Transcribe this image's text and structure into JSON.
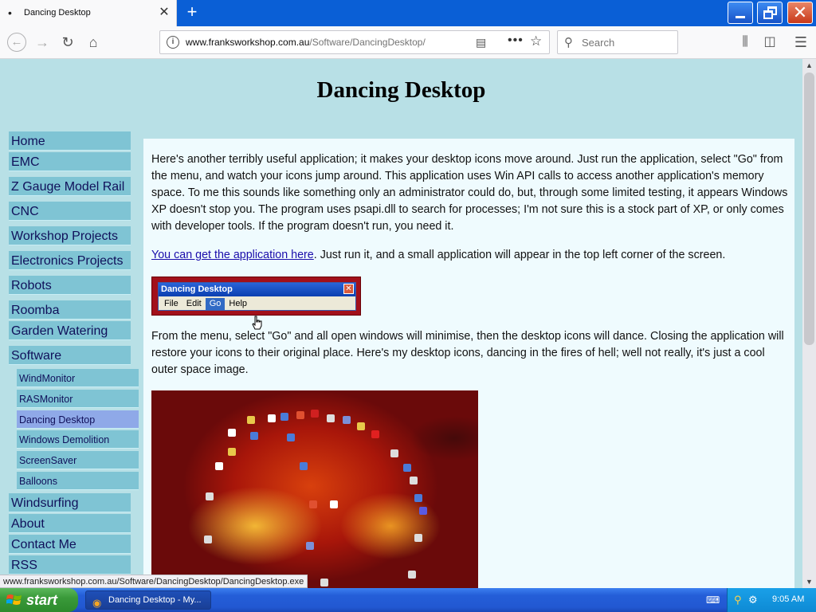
{
  "browser": {
    "tab_title": "Dancing Desktop",
    "tab_dot": "•",
    "url_host": "www.franksworkshop.com.au",
    "url_path": "/Software/DancingDesktop/",
    "search_placeholder": "Search"
  },
  "page": {
    "title": "Dancing Desktop",
    "nav": [
      {
        "label": "Home"
      },
      {
        "label": "EMC"
      },
      {
        "label": "Z Gauge Model Rail"
      },
      {
        "label": "CNC"
      },
      {
        "label": "Workshop Projects"
      },
      {
        "label": "Electronics Projects"
      },
      {
        "label": "Robots"
      },
      {
        "label": "Roomba"
      },
      {
        "label": "Garden Watering"
      },
      {
        "label": "Software"
      }
    ],
    "subnav": [
      {
        "label": "WindMonitor"
      },
      {
        "label": "RASMonitor"
      },
      {
        "label": "Dancing Desktop"
      },
      {
        "label": "Windows Demolition"
      },
      {
        "label": "ScreenSaver"
      },
      {
        "label": "Balloons"
      }
    ],
    "nav_after": [
      {
        "label": "Windsurfing"
      },
      {
        "label": "About"
      },
      {
        "label": "Contact Me"
      },
      {
        "label": "RSS"
      }
    ],
    "para1": "Here's another terribly useful application; it makes your desktop icons move around. Just run the application, select \"Go\" from the menu, and watch your icons jump around.  This application uses Win API calls to access another application's memory space.  To me this sounds like something only an administrator could do, but, through some limited testing, it appears Windows XP doesn't stop you.  The program uses psapi.dll to search for processes; I'm not sure this is a stock part of XP, or only comes with developer tools.  If the program doesn't run, you need it.",
    "para2_link": "You can get the application here",
    "para2_rest": ". Just run it, and a small application will appear in the top left corner of the screen.",
    "para3": "From the menu, select \"Go\" and all open windows will minimise, then the desktop icons will dance.  Closing the application will restore your icons to their original place.  Here's my desktop icons, dancing in the fires of hell; well not really, it's just a cool outer space image.",
    "app_window": {
      "caption": "Dancing Desktop",
      "menu": [
        "File",
        "Edit",
        "Go",
        "Help"
      ],
      "selected_menu": "Go"
    }
  },
  "status_url": "www.franksworkshop.com.au/Software/DancingDesktop/DancingDesktop.exe",
  "taskbar": {
    "start_label": "start",
    "task_label": "Dancing Desktop - My...",
    "clock": "9:05 AM"
  },
  "colors": {
    "page_bg": "#b8e0e6",
    "content_bg": "#effbfe",
    "nav_bg": "#7fc4d4",
    "nav_active": "#8fa9e8",
    "link": "#1a0dab"
  }
}
